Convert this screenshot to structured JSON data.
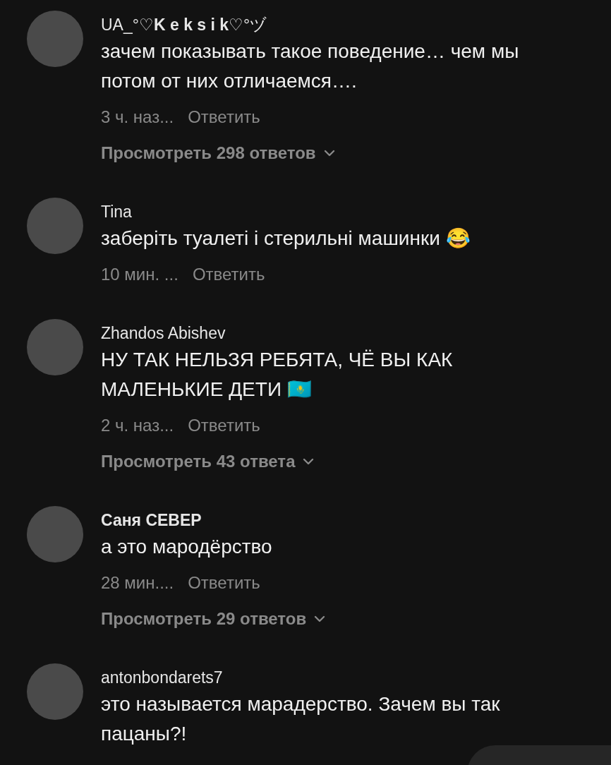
{
  "comments": [
    {
      "username": "UA_°♡**K e k s i k**♡°ヅ",
      "bold": false,
      "text": "зачем показывать такое поведение… чем мы потом от них отличаемся….",
      "time": "3 ч. наз...",
      "reply": "Ответить",
      "view_replies": "Просмотреть 298 ответов"
    },
    {
      "username": "Tina",
      "bold": false,
      "text": "заберіть туалеті і стерильні машинки 😂",
      "time": "10 мин. ...",
      "reply": "Ответить"
    },
    {
      "username": "Zhandos Abishev",
      "bold": false,
      "text": "НУ ТАК НЕЛЬЗЯ РЕБЯТА, ЧЁ ВЫ КАК МАЛЕНЬКИЕ ДЕТИ 🇰🇿",
      "time": "2 ч. наз...",
      "reply": "Ответить",
      "view_replies": "Просмотреть 43 ответа"
    },
    {
      "username": "Саня СЕВЕР",
      "bold": true,
      "text": "а это мародёрство",
      "time": "28 мин....",
      "reply": "Ответить",
      "view_replies": "Просмотреть 29 ответов"
    },
    {
      "username": "antonbondarets7",
      "bold": false,
      "text": "это называется марадерство. Зачем вы так пацаны?!"
    }
  ]
}
